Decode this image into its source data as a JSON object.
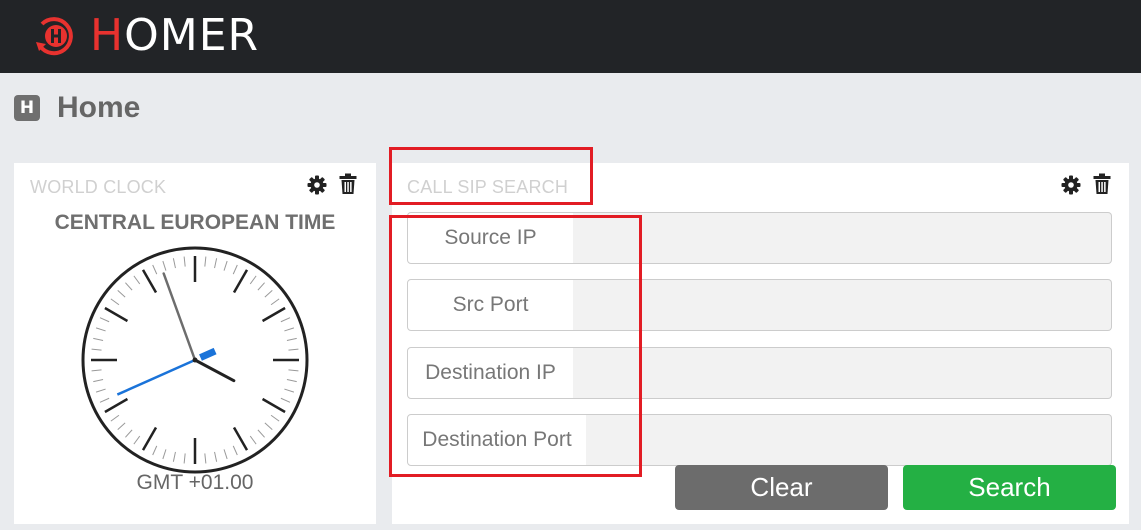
{
  "app": {
    "brand_first_letter": "H",
    "brand_rest": "OMER",
    "logo_icon": "homer-logo-icon",
    "accent_color": "#e8322f"
  },
  "breadcrumb": {
    "icon_letter": "H",
    "title": "Home"
  },
  "world_clock": {
    "title": "WORLD CLOCK",
    "zone_name": "CENTRAL EUROPEAN TIME",
    "offset": "GMT +01.00",
    "time_shown": {
      "hours": 3,
      "minutes": 56,
      "seconds": 41
    },
    "icons": [
      "gear-icon",
      "trash-icon"
    ]
  },
  "call_sip_search": {
    "title": "CALL SIP SEARCH",
    "fields": [
      {
        "label": "Source IP",
        "value": ""
      },
      {
        "label": "Src Port",
        "value": ""
      },
      {
        "label": "Destination IP",
        "value": ""
      },
      {
        "label": "Destination Port",
        "value": ""
      }
    ],
    "clear_label": "Clear",
    "search_label": "Search",
    "icons": [
      "gear-icon",
      "trash-icon"
    ],
    "button_colors": {
      "clear": "#6c6c6c",
      "search": "#24b044"
    }
  },
  "annotations": {
    "highlight_color": "#e21c24"
  }
}
